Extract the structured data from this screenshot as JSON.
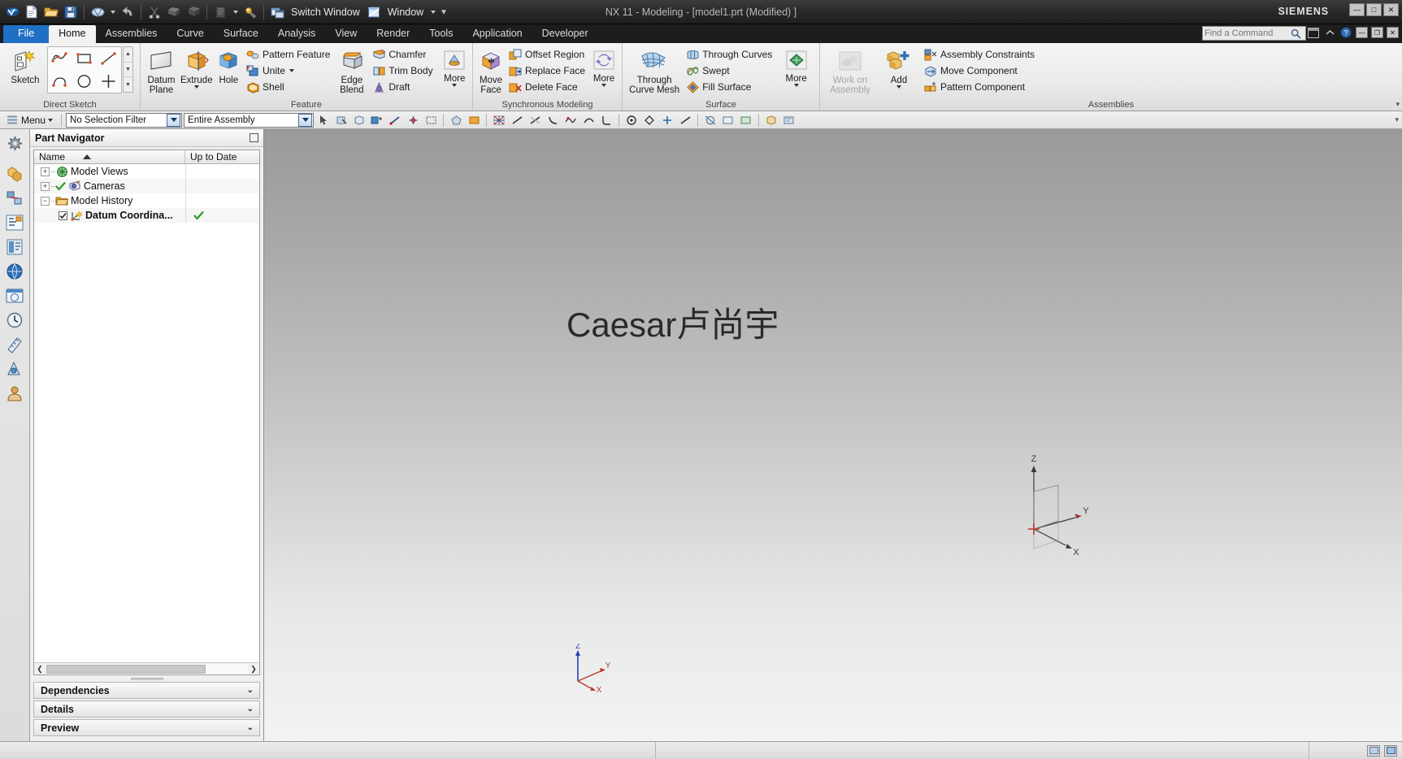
{
  "window": {
    "title": "NX 11 - Modeling - [model1.prt (Modified) ]",
    "brand": "SIEMENS",
    "minimize": "—",
    "maximize": "□",
    "close": "✕"
  },
  "quick_access": {
    "switch_window_label": "Switch Window",
    "window_label": "Window",
    "items": [
      {
        "name": "nx-logo-icon"
      },
      {
        "name": "new-file-icon"
      },
      {
        "name": "open-folder-icon"
      },
      {
        "name": "save-icon"
      },
      {
        "name": "print-icon"
      },
      {
        "name": "undo-icon"
      },
      {
        "name": "redo-icon"
      },
      {
        "name": "cut-icon"
      },
      {
        "name": "copy-icon"
      },
      {
        "name": "paste-icon"
      },
      {
        "name": "customize-icon"
      }
    ]
  },
  "tabs": [
    {
      "id": "file",
      "label": "File",
      "state": "file"
    },
    {
      "id": "home",
      "label": "Home",
      "state": "active"
    },
    {
      "id": "assemblies",
      "label": "Assemblies",
      "state": ""
    },
    {
      "id": "curve",
      "label": "Curve",
      "state": ""
    },
    {
      "id": "surface",
      "label": "Surface",
      "state": ""
    },
    {
      "id": "analysis",
      "label": "Analysis",
      "state": ""
    },
    {
      "id": "view",
      "label": "View",
      "state": ""
    },
    {
      "id": "render",
      "label": "Render",
      "state": ""
    },
    {
      "id": "tools",
      "label": "Tools",
      "state": ""
    },
    {
      "id": "application",
      "label": "Application",
      "state": ""
    },
    {
      "id": "developer",
      "label": "Developer",
      "state": ""
    }
  ],
  "find_command": {
    "placeholder": "Find a Command",
    "icon": "search-icon"
  },
  "ribbon": {
    "groups": {
      "direct_sketch": {
        "label": "Direct Sketch",
        "sketch_label": "Sketch",
        "palette": [
          "profile-icon",
          "rectangle-icon",
          "line-icon",
          "arc-icon",
          "circle-icon",
          "point-icon"
        ]
      },
      "feature": {
        "label": "Feature",
        "datum_plane": "Datum\nPlane",
        "datum_plane_label": "Datum Plane",
        "extrude_label": "Extrude",
        "hole_label": "Hole",
        "pattern_feature_label": "Pattern Feature",
        "unite_label": "Unite",
        "shell_label": "Shell",
        "edge_blend_label": "Edge Blend",
        "chamfer_label": "Chamfer",
        "trim_body_label": "Trim Body",
        "draft_label": "Draft",
        "more_label": "More"
      },
      "synchronous_modeling": {
        "label": "Synchronous Modeling",
        "move_face_label": "Move Face",
        "offset_region_label": "Offset Region",
        "replace_face_label": "Replace Face",
        "delete_face_label": "Delete Face",
        "more_label": "More"
      },
      "surface": {
        "label": "Surface",
        "through_curve_mesh_label": "Through Curve Mesh",
        "through_curves_label": "Through Curves",
        "swept_label": "Swept",
        "fill_surface_label": "Fill Surface",
        "more_label": "More"
      },
      "assemblies": {
        "label": "Assemblies",
        "work_on_assembly_label": "Work on Assembly",
        "add_label": "Add",
        "assembly_constraints_label": "Assembly Constraints",
        "move_component_label": "Move Component",
        "pattern_component_label": "Pattern Component"
      }
    }
  },
  "selection_bar": {
    "menu_label": "Menu",
    "selection_filter": "No Selection Filter",
    "scope": "Entire Assembly",
    "icons": [
      "select-general-icon",
      "select-feature-icon",
      "select-body-icon",
      "select-face-icon",
      "select-edge-icon",
      "snap-point-icon",
      "rectangle-select-icon",
      "polygon-select-icon",
      "face-select-icon",
      "curve-rule-icon",
      "single-curve-icon",
      "connected-curves-icon",
      "tangent-curves-icon",
      "feature-curves-icon",
      "region-boundary-icon",
      "infer-curve-icon",
      "stop-at-intersection-icon",
      "follow-fillet-icon",
      "chain-within-features-icon",
      "curve-select-icon",
      "show-hide-icon",
      "immediate-hide-icon",
      "show-all-icon",
      "show-by-type-icon",
      "edit-object-display-icon"
    ]
  },
  "resource_bar": {
    "items": [
      {
        "name": "settings-gear-icon"
      },
      {
        "name": "assembly-navigator-icon"
      },
      {
        "name": "constraint-navigator-icon"
      },
      {
        "name": "part-navigator-icon"
      },
      {
        "name": "reuse-library-icon"
      },
      {
        "name": "html-help-icon"
      },
      {
        "name": "web-browser-icon"
      },
      {
        "name": "history-icon"
      },
      {
        "name": "measure-icon"
      },
      {
        "name": "process-studio-icon"
      },
      {
        "name": "roles-icon"
      }
    ]
  },
  "part_navigator": {
    "title": "Part Navigator",
    "columns": [
      "Name",
      "Up to Date"
    ],
    "sort_column": "Name",
    "sort_direction": "ascending",
    "rows": [
      {
        "label": "Model Views",
        "expander": "+",
        "indent": 0,
        "icon": "model-views-icon",
        "has_check": false,
        "checked": false,
        "up_to_date": ""
      },
      {
        "label": "Cameras",
        "expander": "+",
        "indent": 0,
        "icon": "cameras-icon",
        "has_check": false,
        "checked": false,
        "status_mark": "✔",
        "up_to_date": ""
      },
      {
        "label": "Model History",
        "expander": "−",
        "indent": 0,
        "icon": "folder-icon",
        "has_check": false,
        "checked": false,
        "up_to_date": ""
      },
      {
        "label": "Datum Coordina...",
        "expander": "",
        "indent": 1,
        "icon": "datum-csys-icon",
        "has_check": true,
        "checked": true,
        "up_to_date": "✔"
      }
    ],
    "sections": [
      {
        "label": "Dependencies",
        "chevron": "⌄"
      },
      {
        "label": "Details",
        "chevron": "⌄"
      },
      {
        "label": "Preview",
        "chevron": "⌄"
      }
    ]
  },
  "graphics": {
    "watermark": "Caesar卢尚宇",
    "wcs": {
      "x_label": "X",
      "y_label": "Y",
      "z_label": "Z"
    },
    "triad": {
      "x_label": "X",
      "y_label": "Y",
      "z_label": "Z"
    }
  },
  "status_bar": {
    "message": ""
  },
  "colors": {
    "file_tab": "#1f6fc4",
    "active_tab": "#f2f2f2",
    "titlebar": "#2a2a2a",
    "ribbon": "#eaeaea",
    "panel": "#f0f0f0",
    "check_green": "#2c9a2c",
    "axis_red": "#c23a3a",
    "axis_blue": "#2b3fb5"
  }
}
